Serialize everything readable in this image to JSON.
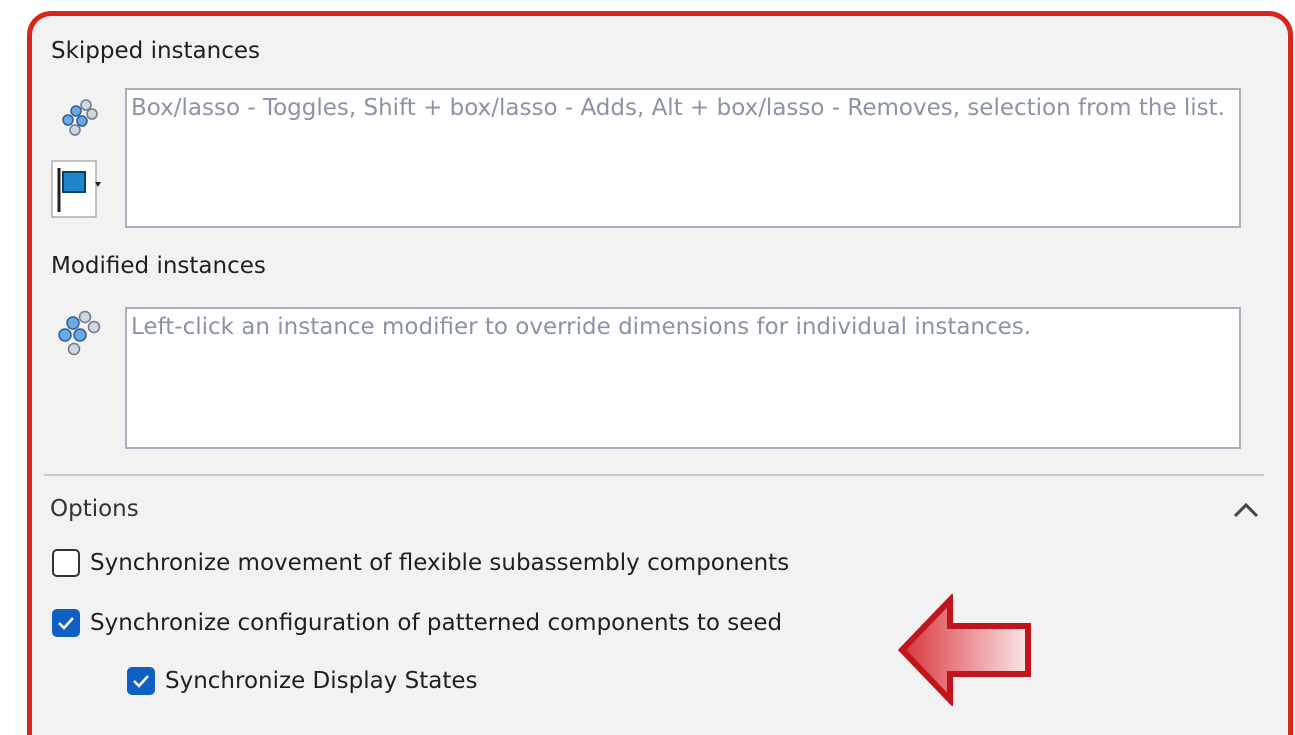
{
  "skipped": {
    "title": "Skipped instances",
    "hint": "Box/lasso - Toggles, Shift + box/lasso - Adds, Alt + box/lasso - Removes, selection from the list."
  },
  "modified": {
    "title": "Modified instances",
    "hint": "Left-click an instance modifier to override dimensions for individual instances."
  },
  "options": {
    "title": "Options",
    "items": [
      {
        "label": "Synchronize movement of flexible subassembly components",
        "checked": false
      },
      {
        "label": "Synchronize configuration of patterned components to seed",
        "checked": true
      },
      {
        "label": "Synchronize Display States",
        "checked": true
      }
    ]
  },
  "colors": {
    "frame": "#d9261c",
    "checkbox_checked": "#0f5fc4",
    "arrow": "#c0151c"
  }
}
